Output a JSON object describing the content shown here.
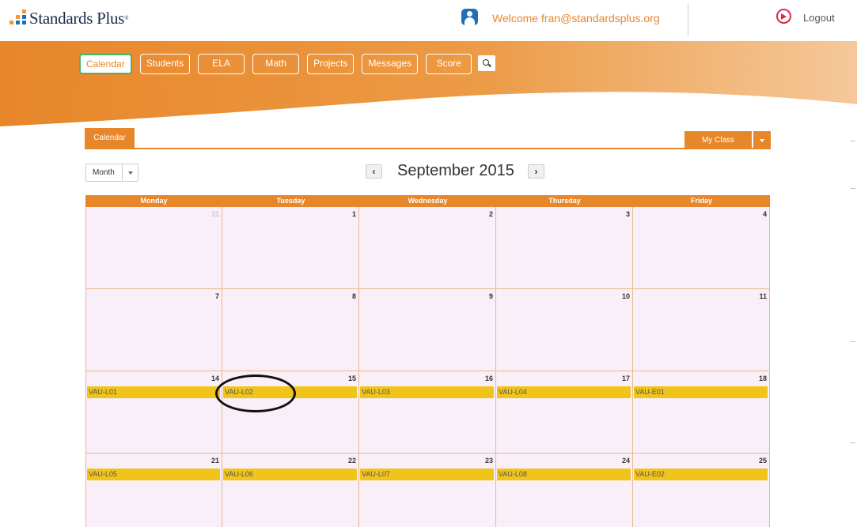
{
  "header": {
    "logo_text": "Standards Plus",
    "logo_trademark": "®",
    "welcome_text": "Welcome fran@standardsplus.org",
    "logout_label": "Logout"
  },
  "nav": {
    "items": [
      "Calendar",
      "Students",
      "ELA",
      "Math",
      "Projects",
      "Messages",
      "Score"
    ],
    "active": "Calendar"
  },
  "tabs": {
    "calendar_tab": "Calendar",
    "class_selector": "My Class"
  },
  "view": {
    "selected": "Month"
  },
  "calendar": {
    "month_title": "September 2015",
    "prev_arrow": "‹",
    "next_arrow": "›",
    "weekdays": [
      "Monday",
      "Tuesday",
      "Wednesday",
      "Thursday",
      "Friday"
    ],
    "weeks": [
      [
        {
          "day": "31",
          "other": true,
          "event": ""
        },
        {
          "day": "1",
          "event": ""
        },
        {
          "day": "2",
          "event": ""
        },
        {
          "day": "3",
          "event": ""
        },
        {
          "day": "4",
          "event": ""
        }
      ],
      [
        {
          "day": "7",
          "event": ""
        },
        {
          "day": "8",
          "event": ""
        },
        {
          "day": "9",
          "event": ""
        },
        {
          "day": "10",
          "event": ""
        },
        {
          "day": "11",
          "event": ""
        }
      ],
      [
        {
          "day": "14",
          "event": "VAU-L01"
        },
        {
          "day": "15",
          "event": "VAU-L02"
        },
        {
          "day": "16",
          "event": "VAU-L03"
        },
        {
          "day": "17",
          "event": "VAU-L04"
        },
        {
          "day": "18",
          "event": "VAU-E01"
        }
      ],
      [
        {
          "day": "21",
          "event": "VAU-L05"
        },
        {
          "day": "22",
          "event": "VAU-L06"
        },
        {
          "day": "23",
          "event": "VAU-L07"
        },
        {
          "day": "24",
          "event": "VAU-L08"
        },
        {
          "day": "25",
          "event": "VAU-E02"
        }
      ]
    ]
  },
  "colors": {
    "brand_orange": "#e8862a",
    "event_yellow": "#f0c419",
    "active_border_green": "#43b76b",
    "user_icon_blue": "#1e6fb8",
    "logout_red": "#d92a4a"
  },
  "icons": [
    "logo-mark-icon",
    "user-icon",
    "logout-icon",
    "search-icon",
    "chevron-left-icon",
    "chevron-right-icon",
    "caret-down-icon"
  ]
}
